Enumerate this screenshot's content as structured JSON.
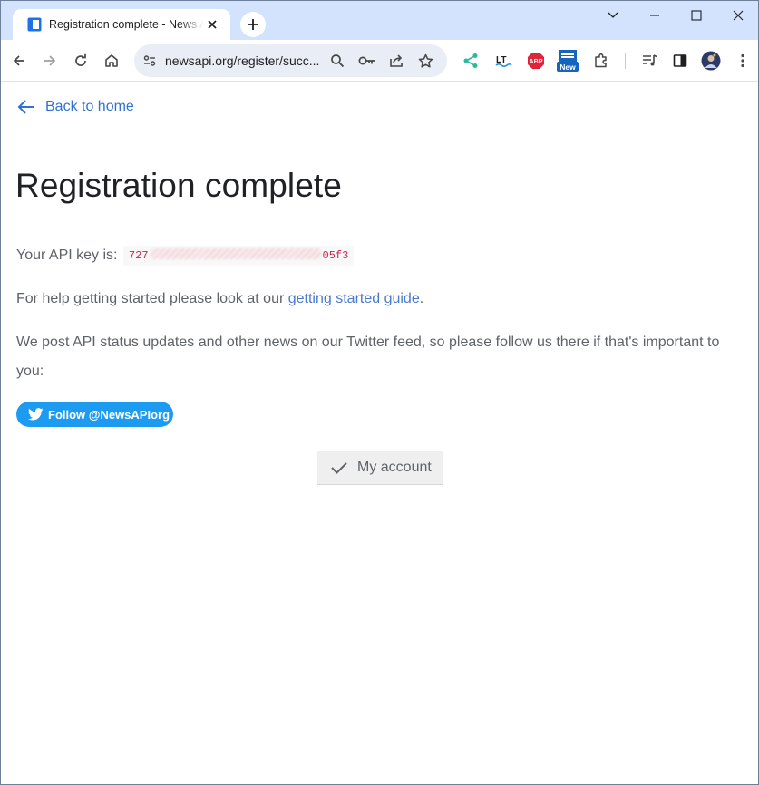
{
  "browser": {
    "tab": {
      "title": "Registration complete - News API",
      "favicon": "newsapi-favicon"
    },
    "new_tab_icon": "plus-icon",
    "window_controls": [
      "chevron-down-icon",
      "minimize-icon",
      "maximize-icon",
      "close-icon"
    ],
    "toolbar": {
      "url": "newsapi.org/register/succ...",
      "buttons": [
        "back-icon",
        "forward-icon",
        "reload-icon",
        "home-icon"
      ],
      "omnibox_icons": [
        "site-settings-icon",
        "zoom-icon",
        "password-key-icon",
        "share-icon",
        "bookmark-star-icon"
      ],
      "extensions": [
        "share-extension-icon",
        "languagetool-icon",
        "adblock-plus-icon",
        "new-extension-icon",
        "extensions-puzzle-icon",
        "media-controls-icon",
        "side-panel-icon",
        "profile-avatar",
        "menu-icon"
      ],
      "abp_label": "ABP",
      "lt_label": "LT",
      "new_badge": "New"
    }
  },
  "page": {
    "back_link": "Back to home",
    "title": "Registration complete",
    "api_key_label": "Your API key is:",
    "api_key_start": "727",
    "api_key_end": "05f3",
    "help_text": "For help getting started please look at our ",
    "help_link": "getting started guide",
    "help_end": ".",
    "twitter_text": "We post API status updates and other news on our Twitter feed, so please follow us there if that's important to you:",
    "twitter_button": "Follow @NewsAPIorg",
    "account_button": "My account"
  },
  "colors": {
    "link": "#3271d2",
    "twitter": "#1d9bf0",
    "key_text": "#c7254e",
    "tabstrip": "#d3e3fd"
  }
}
